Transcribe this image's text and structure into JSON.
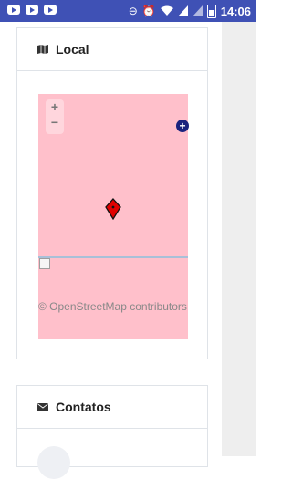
{
  "status_bar": {
    "time": "14:06",
    "notification_icons": [
      "youtube-icon",
      "youtube-icon",
      "youtube-icon"
    ],
    "system_icons": [
      "minus-circle-icon",
      "alarm-icon",
      "wifi-icon",
      "signal-icon",
      "signal-icon",
      "battery-icon"
    ],
    "color": "#3f51b5"
  },
  "local_card": {
    "title": "Local",
    "icon": "map-icon",
    "map": {
      "zoom_in": "+",
      "zoom_out": "−",
      "expand": "+",
      "attribution": "© OpenStreetMap contributors",
      "background_color": "#ffc0cb",
      "marker_color": "#e00000"
    }
  },
  "contatos_card": {
    "title": "Contatos",
    "icon": "envelope-icon"
  }
}
